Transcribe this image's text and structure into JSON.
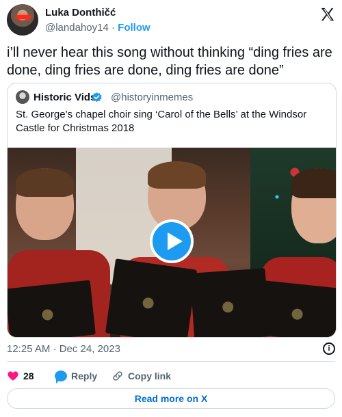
{
  "author": {
    "name": "Luka Donthičć",
    "handle": "@landahoy14",
    "separator": "·",
    "follow_label": "Follow"
  },
  "tweet": {
    "text": "i’ll never hear this song without thinking “ding fries are done, ding fries are done, ding fries are done”"
  },
  "quoted": {
    "name": "Historic Vids",
    "handle": "@historyinmemes",
    "text": "St. George’s chapel choir sing ‘Carol of the Bells’ at the Windsor Castle for Christmas 2018"
  },
  "meta": {
    "timestamp": "12:25 AM · Dec 24, 2023"
  },
  "actions": {
    "likes": "28",
    "reply_label": "Reply",
    "copy_label": "Copy link"
  },
  "footer": {
    "read_more_label": "Read more on X"
  },
  "colors": {
    "accent": "#1d9bf0",
    "like": "#f91880",
    "text_secondary": "#536471"
  }
}
